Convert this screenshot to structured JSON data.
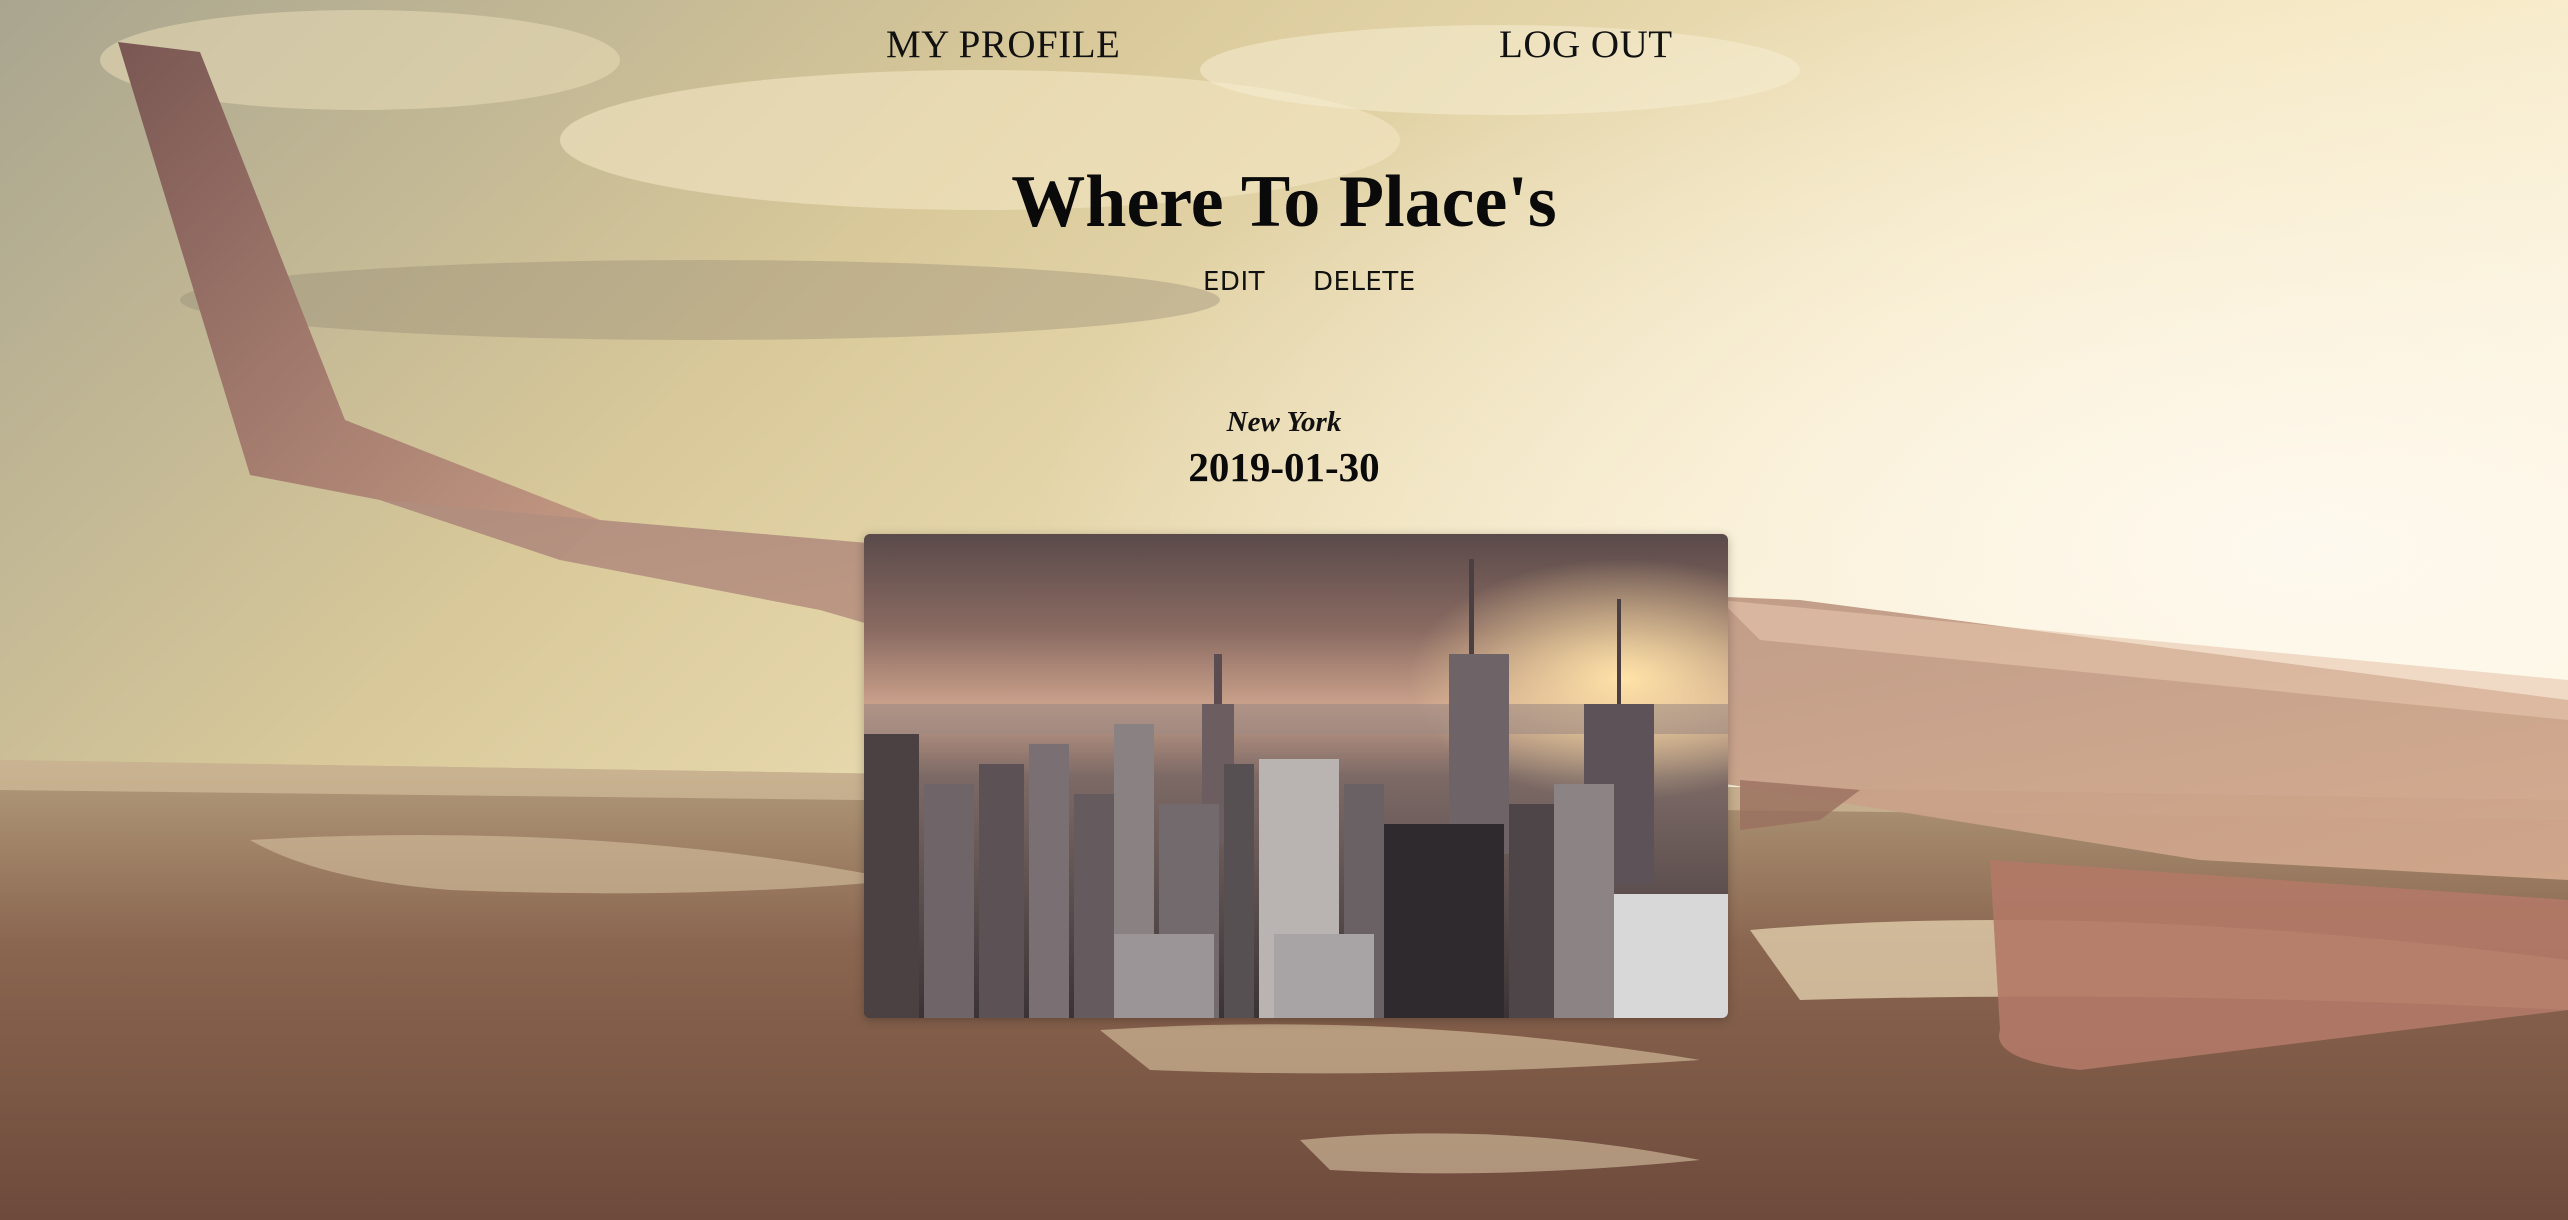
{
  "nav": {
    "my_profile": "MY PROFILE",
    "log_out": "LOG OUT"
  },
  "page": {
    "title": "Where To Place's"
  },
  "actions": {
    "edit": "EDIT",
    "delete": "DELETE"
  },
  "place": {
    "location": "New York",
    "date": "2019-01-30"
  },
  "images": {
    "background": "airplane-wing-sunset",
    "place_photo": "new-york-skyline"
  }
}
